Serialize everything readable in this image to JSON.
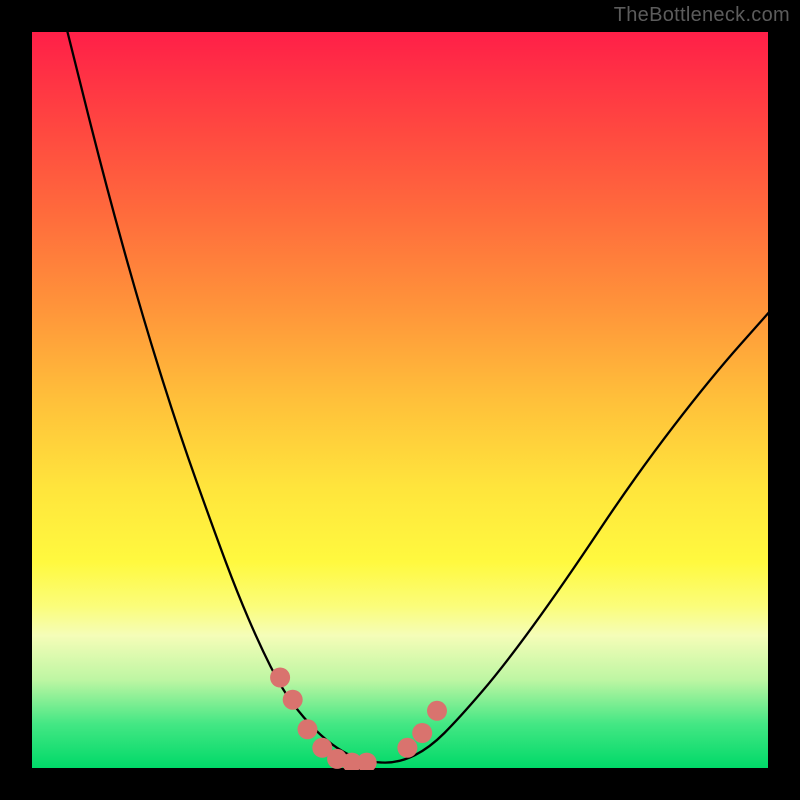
{
  "watermark": "TheBottleneck.com",
  "chart_data": {
    "type": "line",
    "title": "",
    "xlabel": "",
    "ylabel": "",
    "xlim": [
      0,
      1
    ],
    "ylim": [
      0,
      1
    ],
    "curve": {
      "x": [
        0.05,
        0.1,
        0.15,
        0.2,
        0.25,
        0.28,
        0.31,
        0.34,
        0.37,
        0.4,
        0.43,
        0.46,
        0.5,
        0.54,
        0.58,
        0.64,
        0.72,
        0.82,
        0.92,
        1.0
      ],
      "y": [
        1.0,
        0.8,
        0.62,
        0.46,
        0.32,
        0.24,
        0.17,
        0.11,
        0.07,
        0.04,
        0.02,
        0.01,
        0.01,
        0.03,
        0.07,
        0.14,
        0.25,
        0.4,
        0.53,
        0.62
      ]
    },
    "markers": {
      "x": [
        0.338,
        0.355,
        0.375,
        0.395,
        0.415,
        0.435,
        0.455,
        0.51,
        0.53,
        0.55
      ],
      "y": [
        0.125,
        0.095,
        0.055,
        0.03,
        0.015,
        0.01,
        0.01,
        0.03,
        0.05,
        0.08
      ],
      "color": "#d9736e",
      "radius_norm": 0.0135
    }
  }
}
